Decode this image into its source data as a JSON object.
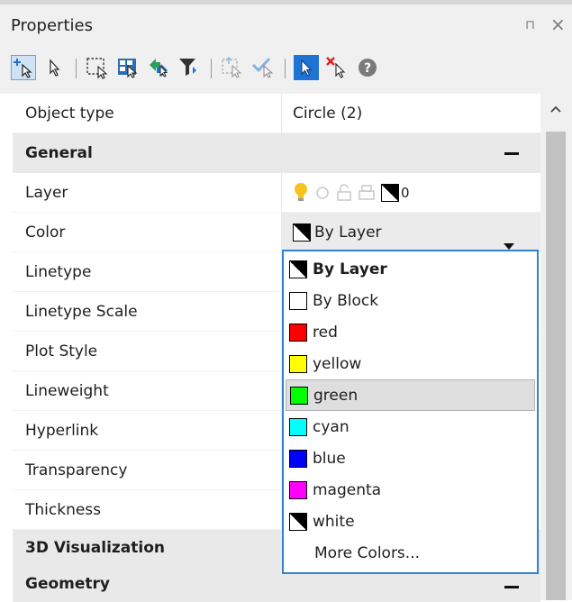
{
  "panel": {
    "title": "Properties",
    "pin_glyph": "⊓",
    "close_glyph": "×"
  },
  "toolbar": {
    "icons": [
      "add-to-selection-icon",
      "select-objects-icon",
      "window-select-icon",
      "select-all-icon",
      "toggle-pickadd-icon",
      "filter-icon",
      "quick-select-icon",
      "select-similar-icon",
      "select-mode-icon",
      "deselect-icon",
      "help-icon"
    ]
  },
  "properties": {
    "object_type": {
      "label": "Object type",
      "value": "Circle (2)"
    },
    "general": {
      "label": "General"
    },
    "layer": {
      "label": "Layer",
      "value": "0"
    },
    "color": {
      "label": "Color",
      "value": "By Layer"
    },
    "linetype": {
      "label": "Linetype"
    },
    "linetype_scale": {
      "label": "Linetype Scale"
    },
    "plot_style": {
      "label": "Plot Style"
    },
    "lineweight": {
      "label": "Lineweight"
    },
    "hyperlink": {
      "label": "Hyperlink"
    },
    "transparency": {
      "label": "Transparency"
    },
    "thickness": {
      "label": "Thickness"
    },
    "visualization_3d": {
      "label": "3D Visualization"
    },
    "geometry": {
      "label": "Geometry"
    }
  },
  "color_dropdown": {
    "items": [
      {
        "label": "By Layer",
        "color": "bylayer",
        "bold": true
      },
      {
        "label": "By Block",
        "color": "#ffffff"
      },
      {
        "label": "red",
        "color": "#ff0000"
      },
      {
        "label": "yellow",
        "color": "#ffff00"
      },
      {
        "label": "green",
        "color": "#00ff00",
        "highlighted": true
      },
      {
        "label": "cyan",
        "color": "#00ffff"
      },
      {
        "label": "blue",
        "color": "#0000ff"
      },
      {
        "label": "magenta",
        "color": "#ff00ff"
      },
      {
        "label": "white",
        "color": "bylayer"
      },
      {
        "label": "More Colors..."
      }
    ]
  },
  "colors": {
    "accent": "#2f83cf",
    "category_bg": "#e9e9e9",
    "toolbar_blue": "#1e73d6"
  }
}
